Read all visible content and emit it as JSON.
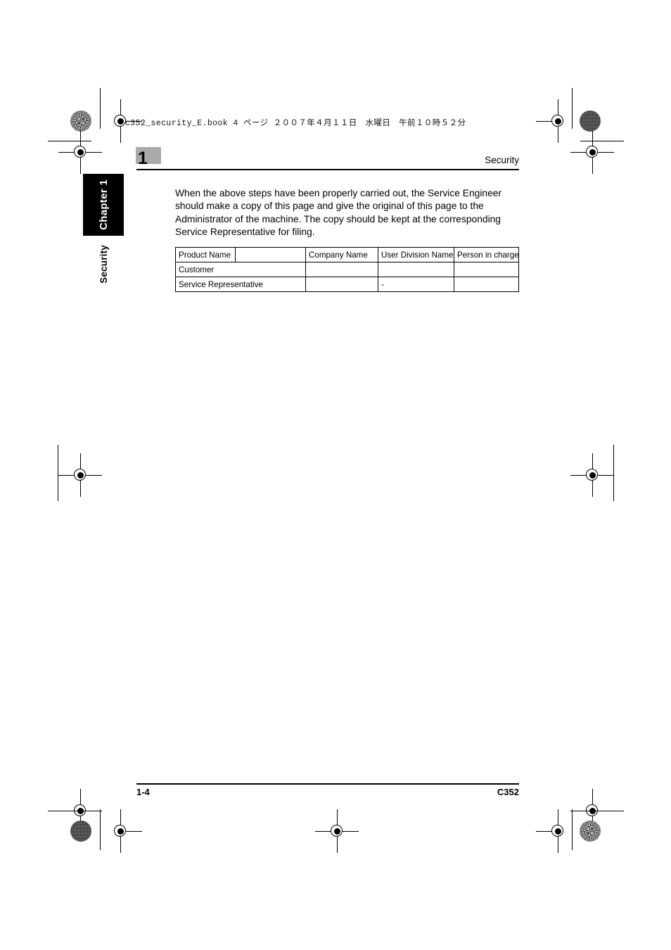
{
  "book_info": {
    "line": "c352_security_E.book  4 ページ  ２００７年４月１１日　水曜日　午前１０時５２分"
  },
  "side_tab": {
    "chapter_label": "Chapter 1",
    "section_label": "Security"
  },
  "running_head": {
    "section_number": "1",
    "title": "Security"
  },
  "body": {
    "paragraph": "When the above steps have been properly carried out, the Service Engineer should make a copy of this page and give the original of this page to the Administrator of the machine. The copy should be kept at the corresponding Service Representative for filing."
  },
  "form_table": {
    "row1": {
      "label": "Product Name",
      "value": "",
      "col_company": "Company Name",
      "col_division": "User Division Name",
      "col_person": "Person in charge"
    },
    "row2": {
      "label": "Customer",
      "company": "",
      "division": "",
      "person": ""
    },
    "row3": {
      "label": "Service Representative",
      "company": "",
      "division": "-",
      "person": ""
    }
  },
  "footer": {
    "page_number": "1-4",
    "model": "C352"
  },
  "colors": {
    "ink": "#000000",
    "badge_gray": "#aaaaaa",
    "tab_black": "#000000"
  }
}
